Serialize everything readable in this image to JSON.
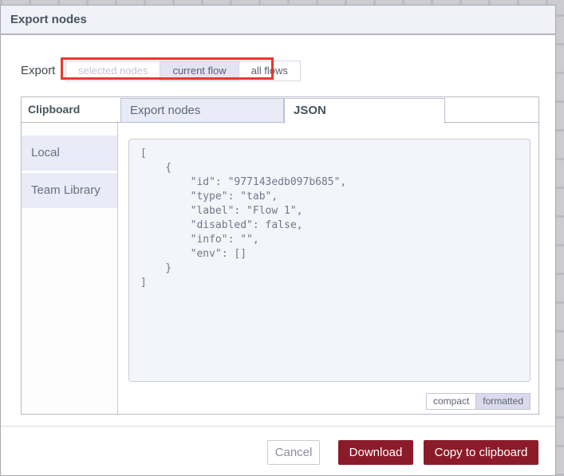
{
  "dialog": {
    "title": "Export nodes",
    "export_row": {
      "label": "Export",
      "options": [
        {
          "label": "selected nodes",
          "state": "disabled"
        },
        {
          "label": "current flow",
          "state": "selected"
        },
        {
          "label": "all flows",
          "state": "normal"
        }
      ]
    },
    "library": {
      "section_label": "Clipboard",
      "tabs": [
        {
          "label": "Export nodes",
          "active": false
        },
        {
          "label": "JSON",
          "active": true
        }
      ],
      "sidebar_items": [
        {
          "label": "Local"
        },
        {
          "label": "Team Library"
        }
      ],
      "code_lines": [
        "[",
        "    {",
        "        \"id\": \"977143edb097b685\",",
        "        \"type\": \"tab\",",
        "        \"label\": \"Flow 1\",",
        "        \"disabled\": false,",
        "        \"info\": \"\",",
        "        \"env\": []",
        "    }",
        "]"
      ],
      "format_toggle": [
        {
          "label": "compact",
          "selected": false
        },
        {
          "label": "formatted",
          "selected": true
        }
      ]
    },
    "footer": {
      "cancel_label": "Cancel",
      "download_label": "Download",
      "copy_label": "Copy to clipboard"
    }
  },
  "annotation": {
    "type": "highlight-box",
    "target": "export scope buttons",
    "color": "#e7392c"
  },
  "colors": {
    "primary_button": "#8c1b2a",
    "inactive_tab_bg": "#e9ebf7",
    "selected_toggle_bg": "#e2e4f2",
    "code_area_bg": "#f4f5fa",
    "header_bg": "#f1f2f9",
    "canvas_bg": "#cbcbd0"
  }
}
